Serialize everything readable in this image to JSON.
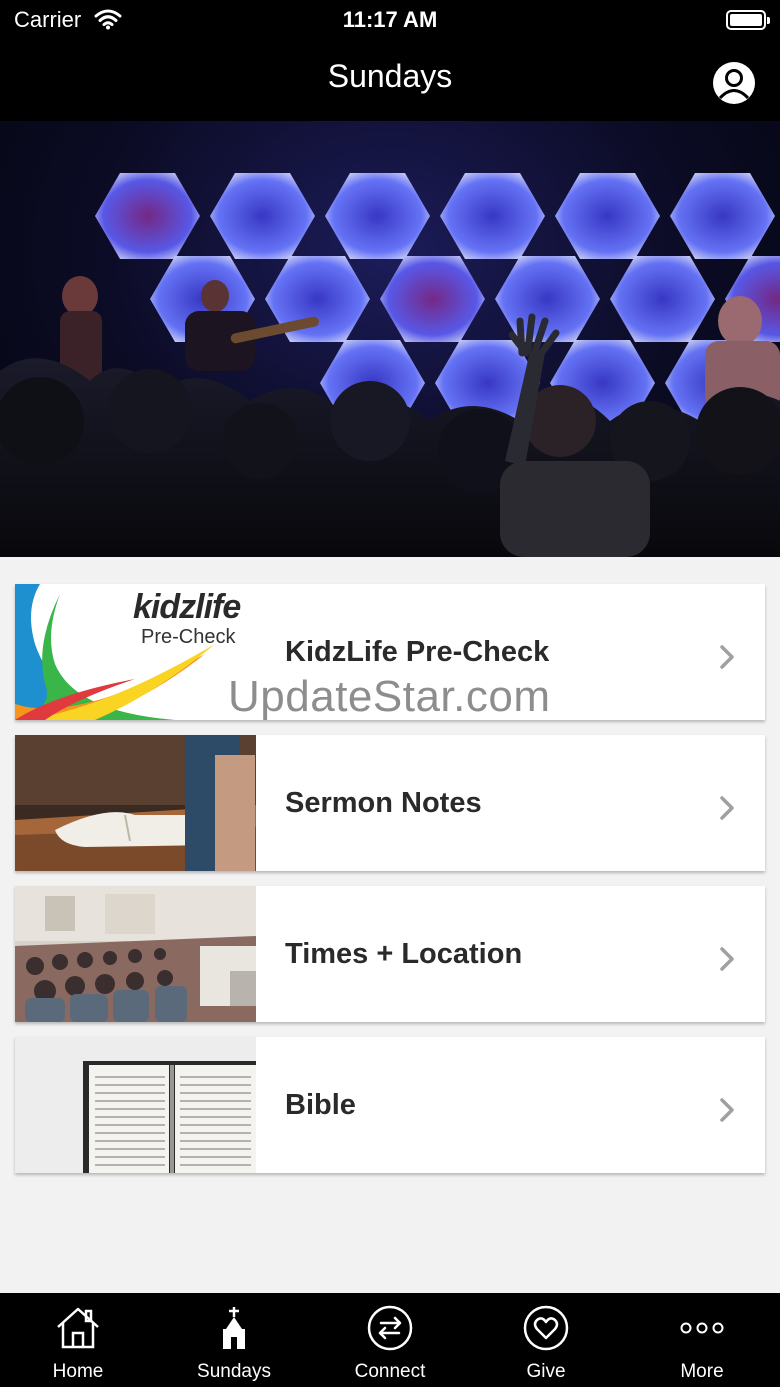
{
  "status_bar": {
    "carrier": "Carrier",
    "time": "11:17 AM"
  },
  "nav": {
    "title": "Sundays"
  },
  "list": {
    "items": [
      {
        "label": "KidzLife Pre-Check",
        "thumb_text_logo": "kidzlife",
        "thumb_text_sub": "Pre-Check"
      },
      {
        "label": "Sermon Notes"
      },
      {
        "label": "Times + Location"
      },
      {
        "label": "Bible"
      }
    ]
  },
  "watermark": "UpdateStar.com",
  "tabs": [
    {
      "label": "Home",
      "icon": "home-icon"
    },
    {
      "label": "Sundays",
      "icon": "church-icon"
    },
    {
      "label": "Connect",
      "icon": "connect-icon"
    },
    {
      "label": "Give",
      "icon": "heart-icon"
    },
    {
      "label": "More",
      "icon": "more-icon"
    }
  ],
  "colors": {
    "bar_background": "#000000",
    "page_background": "#f2f2f2",
    "card_text": "#2a2a2a"
  }
}
